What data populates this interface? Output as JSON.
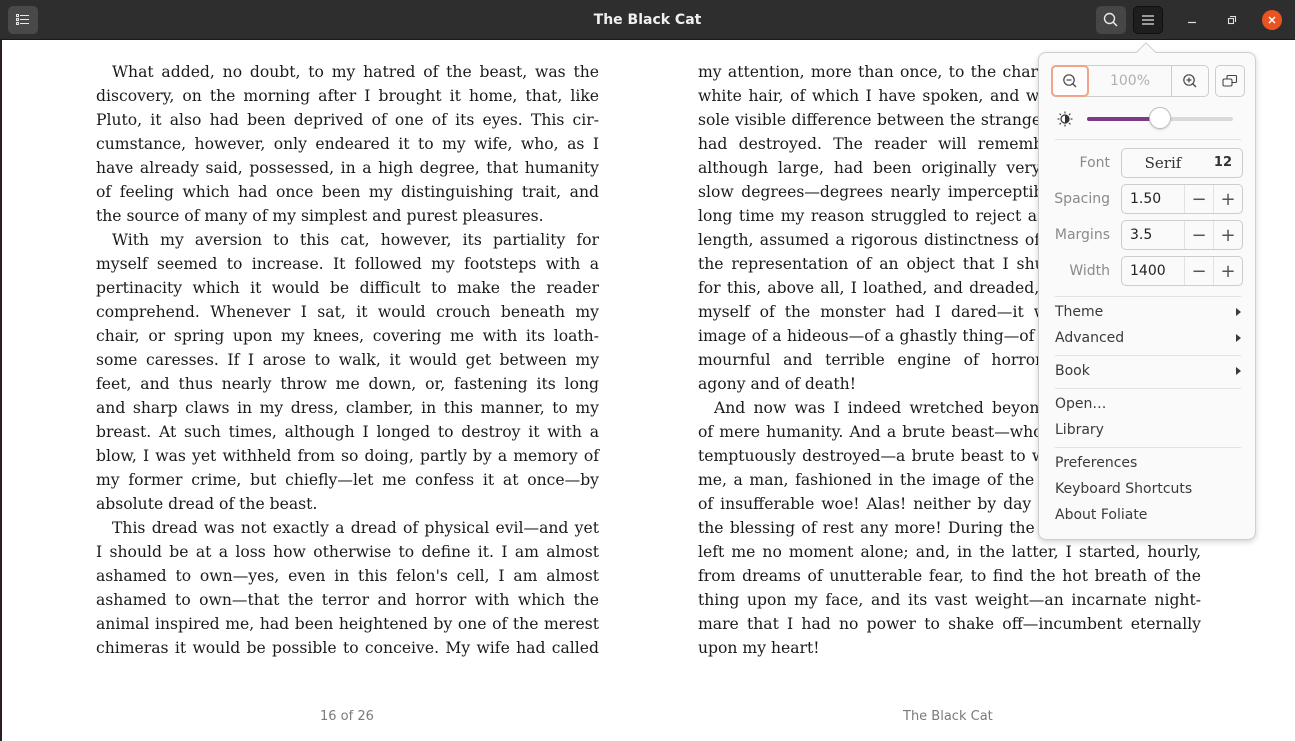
{
  "window": {
    "title": "The Black Cat",
    "buttons": {
      "toc": "table-of-contents-icon",
      "search": "search-icon",
      "menu": "hamburger-menu-icon",
      "minimize": "minimize-icon",
      "maximize": "maximize-icon",
      "close": "close-icon"
    },
    "accent_close": "#e95420"
  },
  "book": {
    "left_page": [
      [
        "What added, no doubt, to my hatred of the beast, was the",
        "discovery, on the morning after I brought it home, that, like",
        "Pluto, it also had been deprived of one of its eyes. This cir-",
        "cumstance, however, only endeared it to my wife, who, as I",
        "have already said, possessed, in a high degree, that humanity",
        "of feeling which had once been my distinguishing trait, and",
        "the source of many of my simplest and purest pleasures."
      ],
      [
        "With my aversion to this cat, however, its partiality for",
        "myself seemed to increase. It followed my footsteps with a",
        "pertinacity which it would be difficult to make the reader",
        "comprehend. Whenever I sat, it would crouch beneath my",
        "chair, or spring upon my knees, covering me with its loath-",
        "some caresses. If I arose to walk, it would get between my",
        "feet, and thus nearly throw me down, or, fastening its long",
        "and sharp claws in my dress, clamber, in this manner, to my",
        "breast. At such times, although I longed to destroy it with a",
        "blow, I was yet withheld from so doing, partly by a memory of",
        "my former crime, but chiefly—let me confess it at once—by",
        "absolute dread of the beast."
      ],
      [
        "This dread was not exactly a dread of physical evil—and yet",
        "I should be at a loss how otherwise to define it. I am almost",
        "ashamed to own—yes, even in this felon's cell, I am almost",
        "ashamed to own—that the terror and horror with which the",
        "animal inspired me, had been heightened by one of the merest",
        "chimeras it would be possible to conceive. My wife had called"
      ]
    ],
    "right_page": [
      [
        "my attention, more than once, to the character of the mark of",
        "white hair, of which I have spoken, and which constituted the",
        "sole visible difference between the strange beast and the one I",
        "had destroyed. The reader will remember that this mark,",
        "although large, had been originally very indefinite; but, by",
        "slow degrees—degrees nearly imperceptible, and which for a",
        "long time my reason struggled to reject as fanciful—it had, at",
        "length, assumed a rigorous distinctness of outline. It was now",
        "the representation of an object that I shudder to name—and",
        "for this, above all, I loathed, and dreaded, and would have rid",
        "myself of the monster had I dared—it was now, I say, the",
        "image of a hideous—of a ghastly thing—of the GALLOWS!—oh,",
        "mournful and terrible engine of horror and of crime—of",
        "agony and of death!"
      ],
      [
        "And now was I indeed wretched beyond the wretchedness",
        "of mere humanity. And a brute beast—whose fellow I had con-",
        "temptuously destroyed—a brute beast to work out for me—for",
        "me, a man, fashioned in the image of the High God—so much",
        "of insufferable woe! Alas! neither by day nor by night knew I",
        "the blessing of rest any more! During the former the creature",
        "left me no moment alone; and, in the latter, I started, hourly,",
        "from dreams of unutterable fear, to find the hot breath of the",
        "thing upon my face, and its vast weight—an incarnate night-",
        "mare that I had no power to shake off—incumbent eternally",
        "upon my heart!"
      ]
    ],
    "footer_left": "16 of 26",
    "footer_right": "The Black Cat"
  },
  "menu_popover": {
    "zoom_level": "100%",
    "brightness_fraction": 0.5,
    "slider_color": "#7d3b85",
    "font_label": "Font",
    "font_name": "Serif",
    "font_size": "12",
    "spacing_label": "Spacing",
    "spacing_value": "1.50",
    "margins_label": "Margins",
    "margins_value": "3.5",
    "width_label": "Width",
    "width_value": "1400",
    "minus": "−",
    "plus": "+",
    "items": {
      "theme": "Theme",
      "advanced": "Advanced",
      "book": "Book",
      "open": "Open…",
      "library": "Library",
      "preferences": "Preferences",
      "shortcuts": "Keyboard Shortcuts",
      "about": "About Foliate"
    }
  }
}
